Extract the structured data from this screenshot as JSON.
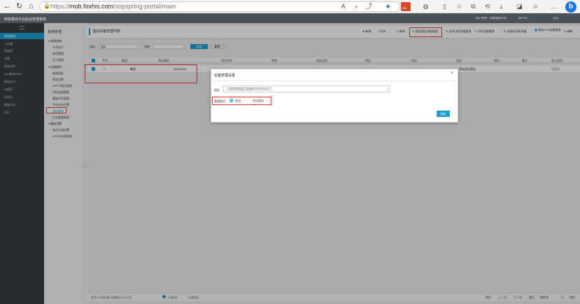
{
  "browser": {
    "url_prefix": "https://",
    "url_host": "mob.foxhis.com",
    "url_path": "/xopspring-portal/main",
    "badge": "130"
  },
  "app": {
    "title": "西软移动平台后台管理系统",
    "top_right": [
      "用户名称：西软管理平台",
      "用户ID：",
      "主页"
    ]
  },
  "left_nav": [
    {
      "label": "基础管理",
      "active": true
    },
    {
      "label": "一码通",
      "active": false
    },
    {
      "label": "西软码",
      "active": false
    },
    {
      "label": "点餐",
      "active": false
    },
    {
      "label": "西软会员",
      "active": false
    },
    {
      "label": "sms移动PMS",
      "active": false
    },
    {
      "label": "移动支付",
      "active": false
    },
    {
      "label": "AI管家",
      "active": false
    },
    {
      "label": "扫码点",
      "active": false
    },
    {
      "label": "渠道平台",
      "active": false
    },
    {
      "label": "评价",
      "active": false
    }
  ],
  "sub_nav": {
    "header": "系统管理",
    "groups": [
      {
        "title": "权限控制",
        "items": [
          "平台用户",
          "角色管理",
          "员工管理"
        ]
      },
      {
        "title": "运维维护",
        "items": [
          "新增酒店",
          "系统设置",
          "APP下载页管理",
          "扫码设备管理",
          "基础代码管理",
          "手机业务设置",
          "酒店管理",
          "日志查看管理"
        ]
      },
      {
        "title": "基础设置",
        "items": [
          "前台分类设置",
          "APP发布版管理"
        ]
      }
    ],
    "selected": "酒店管理"
  },
  "page": {
    "title": "酒店设备管理列表",
    "actions": [
      "新增",
      "同步",
      "修改",
      "酒店酒店设备管理",
      "云付分配设备管理",
      "扫码设备管理",
      "自助机分配设备",
      "酒店ETM设备管理",
      "刷新"
    ]
  },
  "filter": {
    "store_label": "酒店",
    "store_value": "全部",
    "name_label": "名称",
    "search_button": "查询",
    "reset_button": "重置"
  },
  "grid": {
    "columns": [
      "序号",
      "集团",
      "酒店编码",
      "酒店名称",
      "简称",
      "酒店全称",
      "地址",
      "电话",
      "状态",
      "城市",
      "备注",
      "显示状态"
    ],
    "rows": [
      {
        "index": "1",
        "group": "集团",
        "code": "00000000",
        "name": "",
        "note": "西软测试酒店"
      }
    ]
  },
  "footer": {
    "summary": "总共 [1] 条记录 当前显示 [1/1] 页",
    "page_size": "10条/页",
    "goto": "100条/页",
    "pager": [
      "首页",
      "上一页",
      "下一页",
      "尾页",
      "跳转到",
      "页",
      "跳转"
    ]
  },
  "dialog": {
    "title": "设备管理设置",
    "store_label": "酒店",
    "store_tag": "西软测试酒店(门店编号:00000000)",
    "mode_label": "管理模式",
    "mode_options": [
      "启用",
      "启用酒店"
    ],
    "mode_selected": 0,
    "save_button": "保存"
  },
  "colors": {
    "accent": "#1e9fd1",
    "nav_bg": "#373d41",
    "highlight": "#e53935"
  }
}
